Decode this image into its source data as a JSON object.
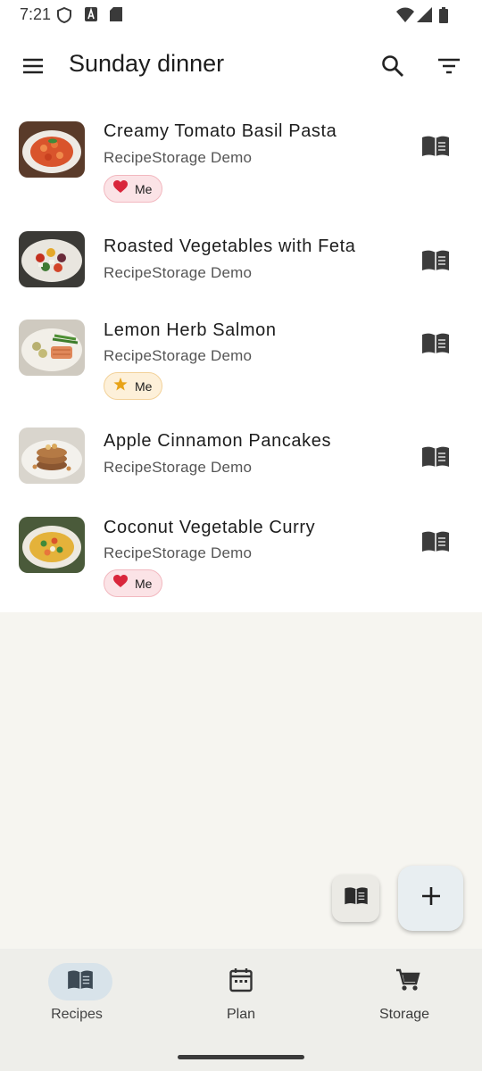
{
  "status_bar": {
    "time": "7:21",
    "icons": [
      "shield-icon",
      "a-box-icon",
      "sd-card-icon",
      "wifi-icon",
      "signal-icon",
      "battery-icon"
    ]
  },
  "app_bar": {
    "title": "Sunday dinner",
    "icons": [
      "menu-icon",
      "search-icon",
      "filter-icon"
    ]
  },
  "recipes": [
    {
      "title": "Creamy Tomato Basil Pasta",
      "source": "RecipeStorage Demo",
      "chip": {
        "type": "heart",
        "label": "Me"
      }
    },
    {
      "title": "Roasted Vegetables with Feta",
      "source": "RecipeStorage Demo",
      "chip": null
    },
    {
      "title": "Lemon Herb Salmon",
      "source": "RecipeStorage Demo",
      "chip": {
        "type": "star",
        "label": "Me"
      }
    },
    {
      "title": "Apple Cinnamon Pancakes",
      "source": "RecipeStorage Demo",
      "chip": null
    },
    {
      "title": "Coconut Vegetable Curry",
      "source": "RecipeStorage Demo",
      "chip": {
        "type": "heart",
        "label": "Me"
      }
    }
  ],
  "fabs": {
    "small_icon": "book-icon",
    "large_icon": "plus-icon"
  },
  "bottom_nav": {
    "items": [
      {
        "label": "Recipes",
        "icon": "book-icon",
        "active": true
      },
      {
        "label": "Plan",
        "icon": "calendar-icon",
        "active": false
      },
      {
        "label": "Storage",
        "icon": "cart-icon",
        "active": false
      }
    ]
  },
  "colors": {
    "heart": "#d9263b",
    "star": "#e8a317",
    "active_nav_pill": "#d8e3ea",
    "background": "#f6f5f0"
  }
}
